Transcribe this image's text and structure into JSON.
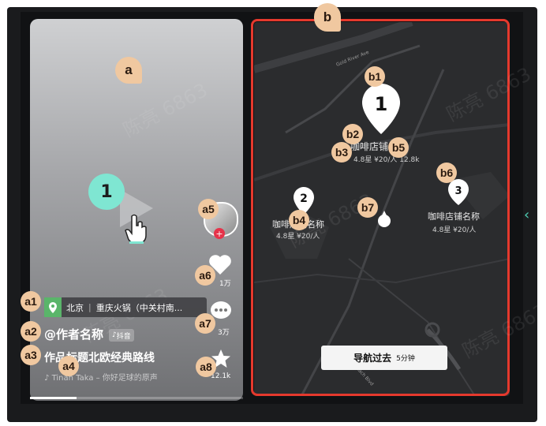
{
  "colors": {
    "accent_red": "#e5392d",
    "badge": "#f0c8a0",
    "mint": "#7fe6d2",
    "heart_red": "#e6334a"
  },
  "labels": {
    "a": "a",
    "a1": "a1",
    "a2": "a2",
    "a3": "a3",
    "a4": "a4",
    "a5": "a5",
    "a6": "a6",
    "a7": "a7",
    "a8": "a8",
    "b": "b",
    "b1": "b1",
    "b2": "b2",
    "b3": "b3",
    "b4": "b4",
    "b5": "b5",
    "b6": "b6",
    "b7": "b7"
  },
  "video": {
    "play_badge": "1",
    "location": {
      "city": "北京",
      "sep": "|",
      "name": "重庆火锅（中关村南..."
    },
    "author": "@作者名称",
    "author_tag": "抖音",
    "title": "作品标题北欧经典路线",
    "music": "Tinah Taka – 你好足球的原声",
    "side": {
      "like_count": "1万",
      "comment_count": "3万",
      "fav_count": "12.1k"
    },
    "progress": 0.22
  },
  "map": {
    "pin1": {
      "num": "1",
      "name": "咖啡店铺名称",
      "meta": "4.8星 ¥20/人 12.8k"
    },
    "pin2": {
      "num": "2",
      "name": "咖啡店铺名称",
      "meta": "4.8星 ¥20/人"
    },
    "pin3": {
      "num": "3",
      "name": "咖啡店铺名称",
      "meta": "4.8星 ¥20/人"
    },
    "streets": [
      "Gold River Ave",
      "Tach Blvd"
    ],
    "nav_button": {
      "label": "导航过去",
      "eta": "5分钟"
    }
  },
  "watermark": "陈亮 6863"
}
